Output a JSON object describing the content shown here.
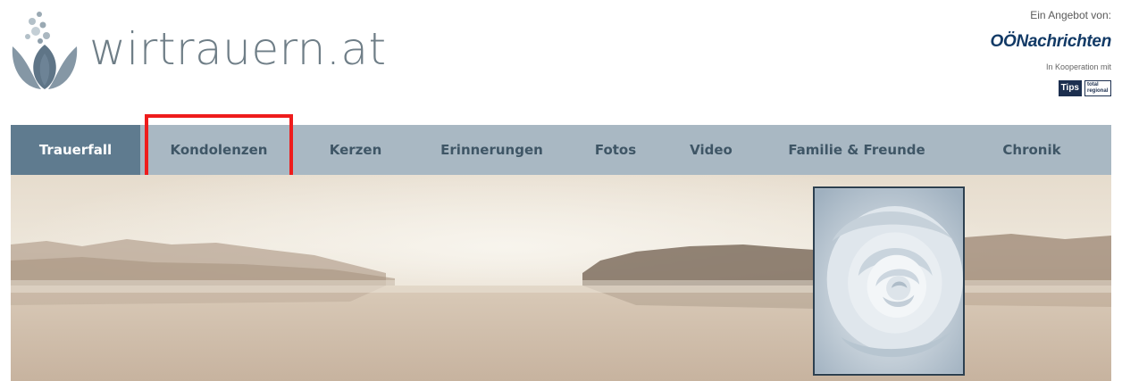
{
  "site": {
    "logo_text": "wirtrauern.at",
    "logo_icon": "tulip-flower-icon"
  },
  "sponsor": {
    "label": "Ein Angebot von:",
    "brand": "OÖNachrichten",
    "cooperation": "In Kooperation mit",
    "partners": [
      "Tips",
      "total regional"
    ]
  },
  "nav": {
    "items": [
      {
        "label": "Trauerfall",
        "active": true
      },
      {
        "label": "Kondolenzen",
        "active": false,
        "highlighted": true
      },
      {
        "label": "Kerzen",
        "active": false
      },
      {
        "label": "Erinnerungen",
        "active": false
      },
      {
        "label": "Fotos",
        "active": false
      },
      {
        "label": "Video",
        "active": false
      },
      {
        "label": "Familie & Freunde",
        "active": false
      },
      {
        "label": "Chronik",
        "active": false
      }
    ]
  },
  "banner": {
    "scene": "misty-lake-landscape",
    "portrait_image": "white-rose-image"
  },
  "colors": {
    "nav_bg": "#a9b8c3",
    "nav_active_bg": "#5f7b8f",
    "nav_text": "#3f5666",
    "highlight": "#ee1c1c",
    "logo_text": "#6f7e87",
    "brand": "#123a66"
  }
}
